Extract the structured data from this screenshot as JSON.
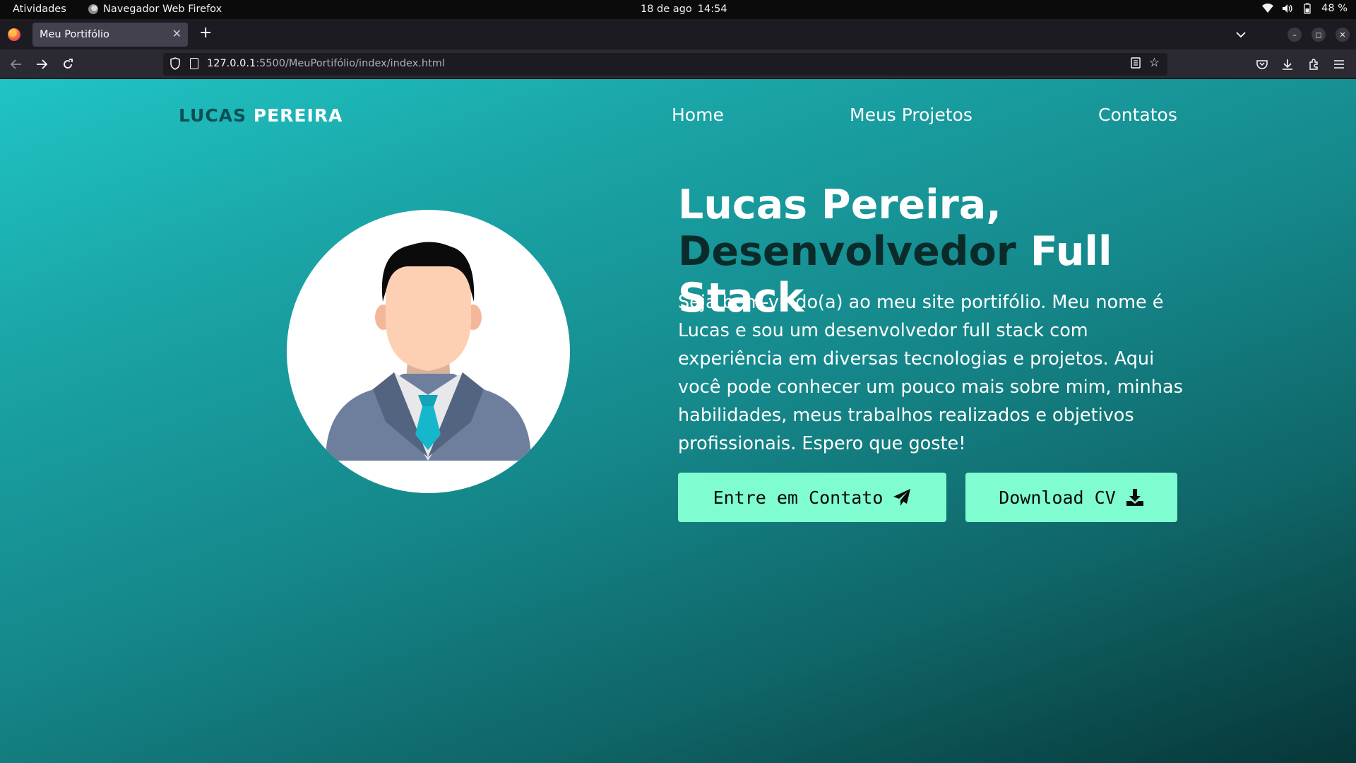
{
  "system_bar": {
    "activities": "Atividades",
    "app_name": "Navegador Web Firefox",
    "date": "18 de ago",
    "time": "14:54",
    "battery": "48 %"
  },
  "browser": {
    "tab_title": "Meu Portifólio",
    "url_host": "127.0.0.1",
    "url_path": ":5500/MeuPortifólio/index/index.html"
  },
  "page": {
    "brand": {
      "first": "LUCAS",
      "last": "PEREIRA"
    },
    "nav": [
      "Home",
      "Meus Projetos",
      "Contatos"
    ],
    "hero": {
      "title_line1": "Lucas Pereira,",
      "title_dark": "Desenvolvedor",
      "title_rest": "Full Stack",
      "text": "Seja bem-vindo(a) ao meu site portifólio. Meu nome é Lucas e sou um desenvolvedor full stack com experiência em diversas tecnologias e projetos. Aqui você pode conhecer um pouco mais sobre mim, minhas habilidades, meus trabalhos realizados e objetivos profissionais. Espero que goste!"
    },
    "buttons": {
      "contact": "Entre em Contato",
      "download": "Download CV"
    }
  },
  "colors": {
    "gradient_start": "#20c4c4",
    "gradient_end": "#073638",
    "button_bg": "#7ffcd0",
    "brand_dark": "#0b4f55"
  },
  "icons": {
    "contact_button": "paper-plane-icon",
    "download_button": "download-icon"
  }
}
